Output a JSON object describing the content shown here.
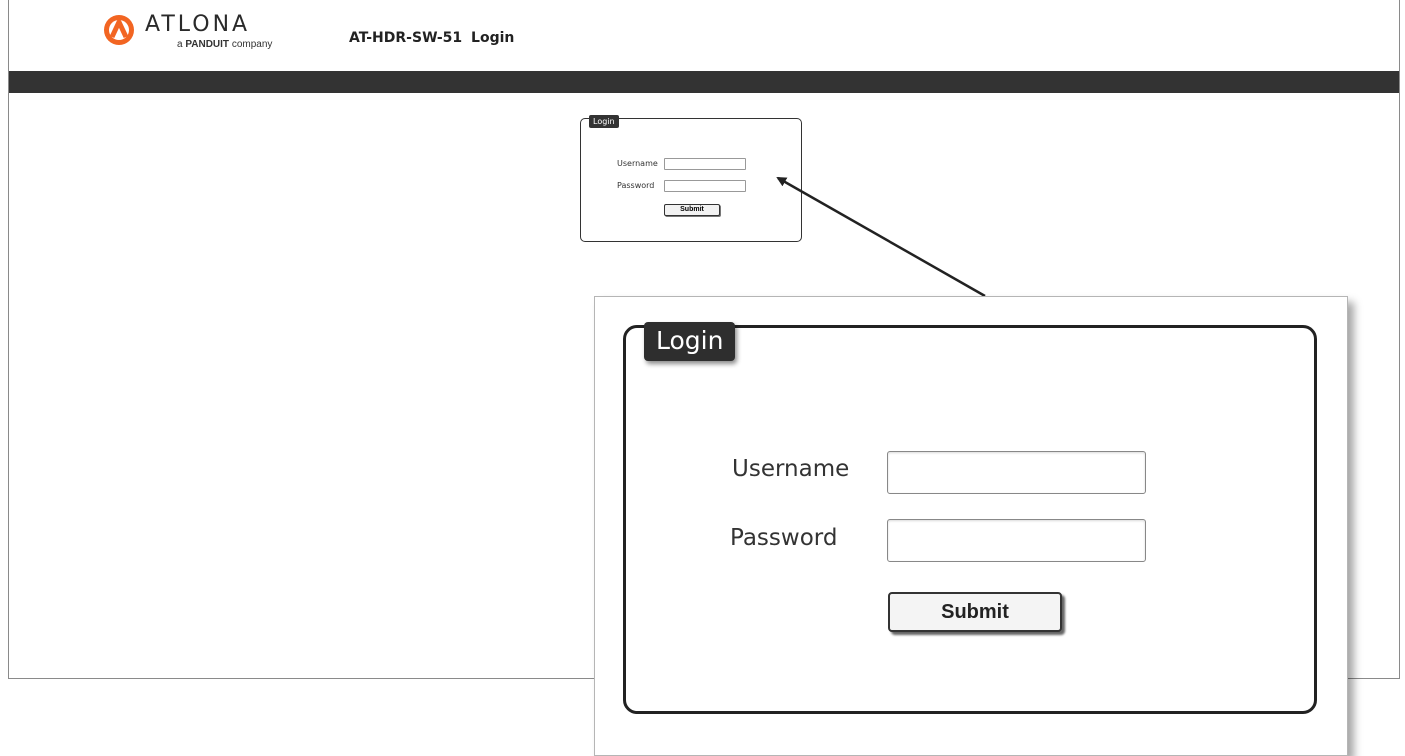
{
  "header": {
    "logo_text": "ATLONA",
    "logo_tagline_prefix": "a",
    "logo_tagline_brand": "PANDUIT",
    "logo_tagline_suffix": "company",
    "title": "AT-HDR-SW-51  Login"
  },
  "login": {
    "legend": "Login",
    "username_label": "Username",
    "password_label": "Password",
    "username_value": "",
    "password_value": "",
    "submit_label": "Submit"
  },
  "callout": {
    "legend": "Login",
    "username_label": "Username",
    "password_label": "Password",
    "submit_label": "Submit"
  },
  "colors": {
    "brand_orange": "#f26522",
    "navbar": "#333333",
    "legend_bg": "#2e2e2e"
  },
  "icons": {
    "logo_mark": "atlona-logo-mark"
  }
}
